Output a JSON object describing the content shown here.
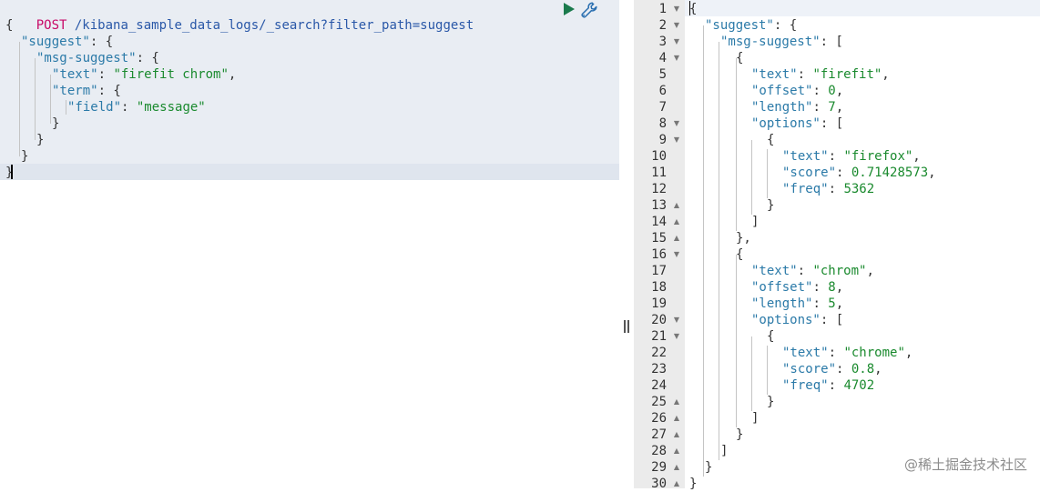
{
  "request": {
    "method": "POST",
    "path": "/kibana_sample_data_logs/_search?filter_path=suggest",
    "lines": [
      [
        {
          "t": "p",
          "v": "{"
        }
      ],
      [
        {
          "t": "k",
          "v": "\"suggest\""
        },
        {
          "t": "p",
          "v": ": {"
        }
      ],
      [
        {
          "t": "k",
          "v": "\"msg-suggest\""
        },
        {
          "t": "p",
          "v": ": {"
        }
      ],
      [
        {
          "t": "k",
          "v": "\"text\""
        },
        {
          "t": "p",
          "v": ": "
        },
        {
          "t": "s",
          "v": "\"firefit chrom\""
        },
        {
          "t": "p",
          "v": ","
        }
      ],
      [
        {
          "t": "k",
          "v": "\"term\""
        },
        {
          "t": "p",
          "v": ": {"
        }
      ],
      [
        {
          "t": "k",
          "v": "\"field\""
        },
        {
          "t": "p",
          "v": ": "
        },
        {
          "t": "s",
          "v": "\"message\""
        }
      ],
      [
        {
          "t": "p",
          "v": "}"
        }
      ],
      [
        {
          "t": "p",
          "v": "}"
        }
      ],
      [
        {
          "t": "p",
          "v": "}"
        }
      ],
      [
        {
          "t": "p",
          "v": "}"
        }
      ]
    ]
  },
  "toolbar": {
    "run_icon": "play-icon",
    "settings_icon": "wrench-icon"
  },
  "response": {
    "lines": [
      [
        {
          "t": "p",
          "v": "{"
        }
      ],
      [
        {
          "t": "k",
          "v": "\"suggest\""
        },
        {
          "t": "p",
          "v": ": {"
        }
      ],
      [
        {
          "t": "k",
          "v": "\"msg-suggest\""
        },
        {
          "t": "p",
          "v": ": ["
        }
      ],
      [
        {
          "t": "p",
          "v": "{"
        }
      ],
      [
        {
          "t": "k",
          "v": "\"text\""
        },
        {
          "t": "p",
          "v": ": "
        },
        {
          "t": "s",
          "v": "\"firefit\""
        },
        {
          "t": "p",
          "v": ","
        }
      ],
      [
        {
          "t": "k",
          "v": "\"offset\""
        },
        {
          "t": "p",
          "v": ": "
        },
        {
          "t": "n",
          "v": "0"
        },
        {
          "t": "p",
          "v": ","
        }
      ],
      [
        {
          "t": "k",
          "v": "\"length\""
        },
        {
          "t": "p",
          "v": ": "
        },
        {
          "t": "n",
          "v": "7"
        },
        {
          "t": "p",
          "v": ","
        }
      ],
      [
        {
          "t": "k",
          "v": "\"options\""
        },
        {
          "t": "p",
          "v": ": ["
        }
      ],
      [
        {
          "t": "p",
          "v": "{"
        }
      ],
      [
        {
          "t": "k",
          "v": "\"text\""
        },
        {
          "t": "p",
          "v": ": "
        },
        {
          "t": "s",
          "v": "\"firefox\""
        },
        {
          "t": "p",
          "v": ","
        }
      ],
      [
        {
          "t": "k",
          "v": "\"score\""
        },
        {
          "t": "p",
          "v": ": "
        },
        {
          "t": "n",
          "v": "0.71428573"
        },
        {
          "t": "p",
          "v": ","
        }
      ],
      [
        {
          "t": "k",
          "v": "\"freq\""
        },
        {
          "t": "p",
          "v": ": "
        },
        {
          "t": "n",
          "v": "5362"
        }
      ],
      [
        {
          "t": "p",
          "v": "}"
        }
      ],
      [
        {
          "t": "p",
          "v": "]"
        }
      ],
      [
        {
          "t": "p",
          "v": "},"
        }
      ],
      [
        {
          "t": "p",
          "v": "{"
        }
      ],
      [
        {
          "t": "k",
          "v": "\"text\""
        },
        {
          "t": "p",
          "v": ": "
        },
        {
          "t": "s",
          "v": "\"chrom\""
        },
        {
          "t": "p",
          "v": ","
        }
      ],
      [
        {
          "t": "k",
          "v": "\"offset\""
        },
        {
          "t": "p",
          "v": ": "
        },
        {
          "t": "n",
          "v": "8"
        },
        {
          "t": "p",
          "v": ","
        }
      ],
      [
        {
          "t": "k",
          "v": "\"length\""
        },
        {
          "t": "p",
          "v": ": "
        },
        {
          "t": "n",
          "v": "5"
        },
        {
          "t": "p",
          "v": ","
        }
      ],
      [
        {
          "t": "k",
          "v": "\"options\""
        },
        {
          "t": "p",
          "v": ": ["
        }
      ],
      [
        {
          "t": "p",
          "v": "{"
        }
      ],
      [
        {
          "t": "k",
          "v": "\"text\""
        },
        {
          "t": "p",
          "v": ": "
        },
        {
          "t": "s",
          "v": "\"chrome\""
        },
        {
          "t": "p",
          "v": ","
        }
      ],
      [
        {
          "t": "k",
          "v": "\"score\""
        },
        {
          "t": "p",
          "v": ": "
        },
        {
          "t": "n",
          "v": "0.8"
        },
        {
          "t": "p",
          "v": ","
        }
      ],
      [
        {
          "t": "k",
          "v": "\"freq\""
        },
        {
          "t": "p",
          "v": ": "
        },
        {
          "t": "n",
          "v": "4702"
        }
      ],
      [
        {
          "t": "p",
          "v": "}"
        }
      ],
      [
        {
          "t": "p",
          "v": "]"
        }
      ],
      [
        {
          "t": "p",
          "v": "}"
        }
      ],
      [
        {
          "t": "p",
          "v": "]"
        }
      ],
      [
        {
          "t": "p",
          "v": "}"
        }
      ],
      [
        {
          "t": "p",
          "v": "}"
        }
      ]
    ],
    "line_numbers": [
      "1",
      "2",
      "3",
      "4",
      "5",
      "6",
      "7",
      "8",
      "9",
      "10",
      "11",
      "12",
      "13",
      "14",
      "15",
      "16",
      "17",
      "18",
      "19",
      "20",
      "21",
      "22",
      "23",
      "24",
      "25",
      "26",
      "27",
      "28",
      "29",
      "30"
    ],
    "folds": [
      "down",
      "down",
      "down",
      "down",
      "",
      "",
      "",
      "down",
      "down",
      "",
      "",
      "",
      "up",
      "up",
      "up",
      "down",
      "",
      "",
      "",
      "down",
      "down",
      "",
      "",
      "",
      "up",
      "up",
      "up",
      "up",
      "up",
      "up"
    ]
  },
  "watermark": "@稀土掘金技术社区",
  "colors": {
    "method": "#c80a68",
    "path": "#2a58a8",
    "key": "#2b7aa8",
    "string": "#1a8a2e",
    "run": "#1a7a4c"
  }
}
